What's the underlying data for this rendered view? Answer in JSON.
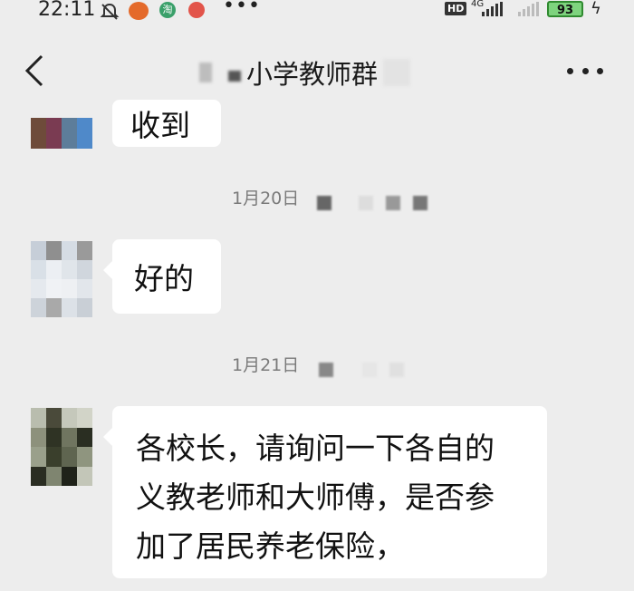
{
  "status_bar": {
    "time": "22:11",
    "hd_label": "HD",
    "network_label": "4G",
    "battery": "93",
    "icons": [
      "bell-muted-icon",
      "app-icon",
      "taobao-icon",
      "app-icon",
      "more-dots-icon",
      "signal-icon",
      "battery-icon",
      "charging-bolt-icon"
    ]
  },
  "header": {
    "title": "小学教师群",
    "back_icon": "chevron-left-icon",
    "more_icon": "more-dots-icon"
  },
  "messages": [
    {
      "type": "text",
      "text": "收到",
      "partial": true
    },
    {
      "type": "timestamp",
      "text": "1月20日"
    },
    {
      "type": "text",
      "text": "好的"
    },
    {
      "type": "timestamp",
      "text": "1月21日"
    },
    {
      "type": "text",
      "lines": [
        "各校长，请询问一下各自的",
        "义教老师和大师傅，是否参",
        "加了居民养老保险，"
      ]
    }
  ],
  "colors": {
    "background": "#ededed",
    "bubble": "#ffffff",
    "timestamp": "#7a7a7a",
    "battery": "#7ed37e"
  }
}
